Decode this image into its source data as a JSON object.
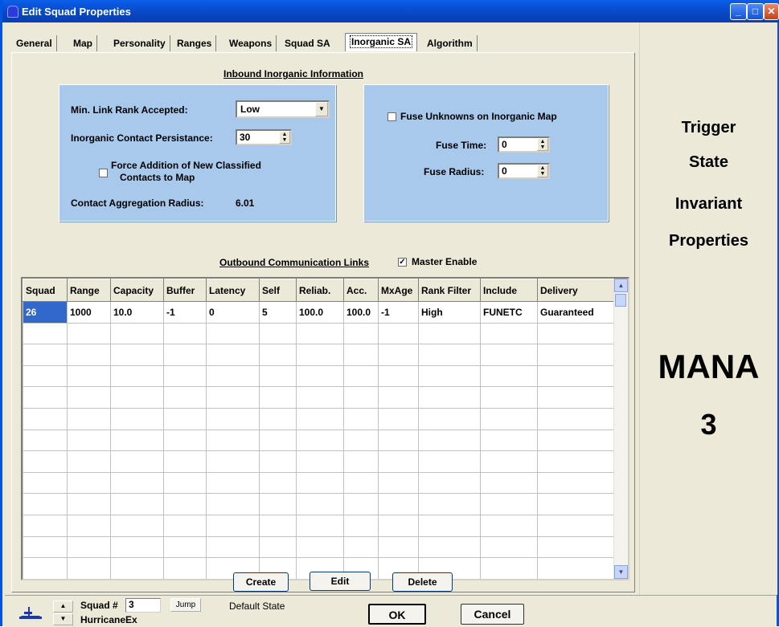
{
  "window": {
    "title": "Edit Squad Properties"
  },
  "tabs": [
    "General",
    "Map",
    "Personality",
    "Ranges",
    "Weapons",
    "Squad SA",
    "Inorganic SA",
    "Algorithm"
  ],
  "active_tab": "Inorganic SA",
  "inbound": {
    "title": "Inbound Inorganic Information",
    "min_link_rank_label": "Min. Link Rank  Accepted:",
    "min_link_rank_value": "Low",
    "persistance_label": "Inorganic Contact Persistance:",
    "persistance_value": "30",
    "force_addition_label": "Force Addition of New Classified",
    "force_addition_label2": "Contacts to Map",
    "aggregation_label": "Contact Aggregation Radius:",
    "aggregation_value": "6.01",
    "fuse_unknowns_label": "Fuse Unknowns on Inorganic Map",
    "fuse_time_label": "Fuse Time:",
    "fuse_time_value": "0",
    "fuse_radius_label": "Fuse Radius:",
    "fuse_radius_value": "0"
  },
  "outbound": {
    "title": "Outbound Communication Links",
    "master_enable_label": "Master Enable",
    "columns": [
      "Squad",
      "Range",
      "Capacity",
      "Buffer",
      "Latency",
      "Self",
      "Reliab.",
      "Acc.",
      "MxAge",
      "Rank Filter",
      "Include",
      "Delivery"
    ],
    "rows": [
      [
        "26",
        "1000",
        "10.0",
        "-1",
        "0",
        "5",
        "100.0",
        "100.0",
        "-1",
        "High",
        "FUNETC",
        "Guaranteed"
      ]
    ]
  },
  "buttons": {
    "create": "Create",
    "edit": "Edit",
    "delete": "Delete",
    "ok": "OK",
    "cancel": "Cancel",
    "jump": "Jump"
  },
  "right_panel": {
    "line1": "Trigger",
    "line2": "State",
    "line3": "Invariant",
    "line4": "Properties",
    "brand": "MANA",
    "version": "3"
  },
  "bottom": {
    "squad_label": "Squad #",
    "squad_value": "3",
    "squad_name": "HurricaneEx",
    "state": "Default State"
  }
}
